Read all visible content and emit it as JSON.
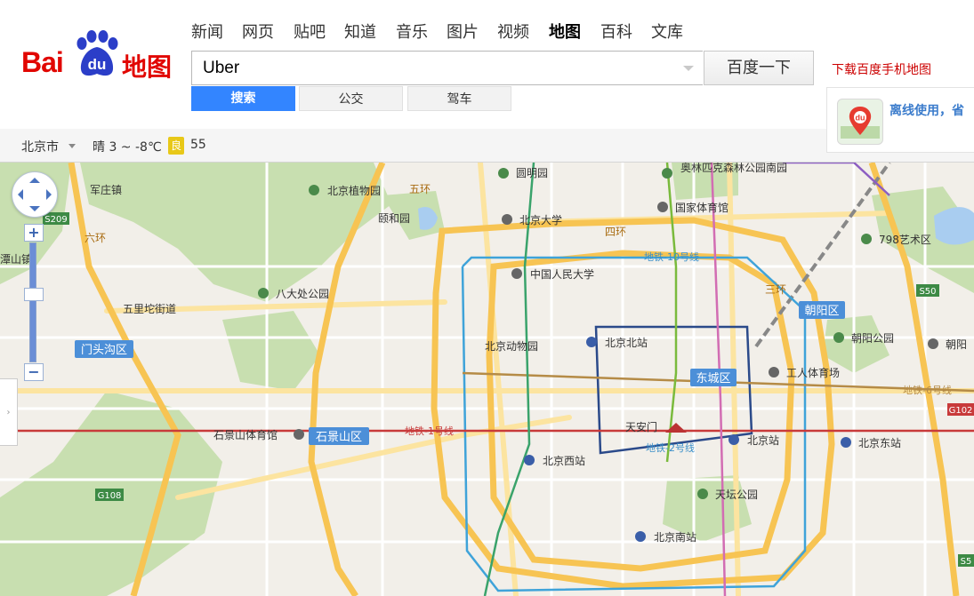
{
  "logo": {
    "bai": "Bai",
    "du": "du",
    "ditu": "地图"
  },
  "nav": [
    "新闻",
    "网页",
    "贴吧",
    "知道",
    "音乐",
    "图片",
    "视频",
    "地图",
    "百科",
    "文库"
  ],
  "nav_active": "地图",
  "search": {
    "value": "Uber",
    "button": "百度一下"
  },
  "tabs": [
    "搜索",
    "公交",
    "驾车"
  ],
  "download_link": "下载百度手机地图",
  "promo": {
    "icon_text": "du",
    "text": "离线使用，省"
  },
  "infobar": {
    "city": "北京市",
    "weather": "晴 3 ~ -8℃",
    "aqi_level": "良",
    "aqi_value": "55"
  },
  "map": {
    "zoom_in": "+",
    "zoom_out": "−",
    "districts": [
      "门头沟区",
      "石景山区",
      "朝阳区",
      "东城区"
    ],
    "line_labels": [
      "地铁-10号线",
      "地铁-1号线",
      "地铁-2号线",
      "地铁-6号线"
    ],
    "ring_labels": [
      "五环",
      "四环",
      "三环",
      "六环"
    ],
    "road_badges": [
      "S209",
      "S50",
      "G102",
      "G108",
      "S5"
    ],
    "poi_labels": [
      "军庄镇",
      "北京植物园",
      "圆明园",
      "奥林匹克森林公园南园",
      "国家体育馆",
      "北京大学",
      "颐和园",
      "中国人民大学",
      "798艺术区",
      "八大处公园",
      "五里坨街道",
      "北京北站",
      "北京动物园",
      "朝阳公园",
      "工人体育场",
      "石景山体育馆",
      "天安门",
      "北京站",
      "北京东站",
      "北京西站",
      "天坛公园",
      "北京南站",
      "朝阳",
      "潭山镇"
    ]
  },
  "colors": {
    "brand_red": "#e10601",
    "brand_blue": "#2b3ec8",
    "tab_blue": "#3385ff",
    "district_label": "#4c8fd8",
    "ring_road": "#f7c453",
    "map_bg": "#f2efe9"
  }
}
